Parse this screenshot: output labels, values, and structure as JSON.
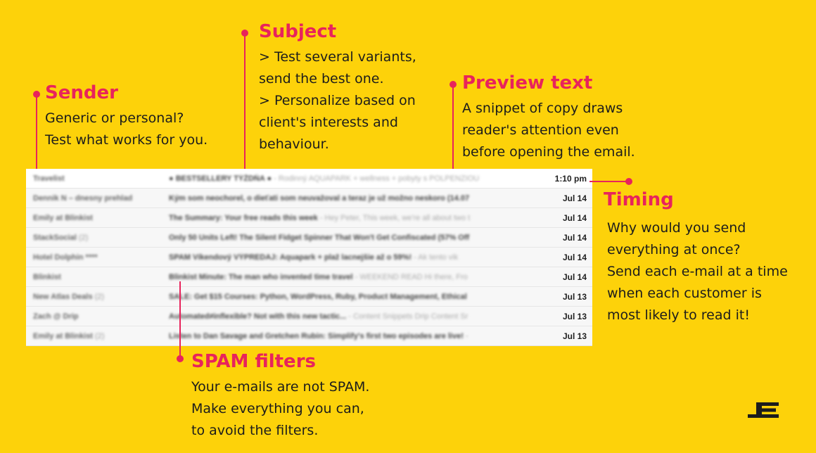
{
  "sender": {
    "title": "Sender",
    "lines": [
      "Generic or personal?",
      "Test what works for you."
    ]
  },
  "subject": {
    "title": "Subject",
    "lines": [
      "> Test several variants,",
      "send the best one.",
      "> Personalize based on",
      "client's interests and",
      "behaviour."
    ]
  },
  "preview": {
    "title": "Preview text",
    "lines": [
      "A snippet of copy draws",
      "reader's attention even",
      "before opening the email."
    ]
  },
  "timing": {
    "title": "Timing",
    "lines": [
      "Why would you send",
      "everything at once?",
      "Send each e-mail at a time",
      "when each customer is",
      "most likely to read it!"
    ]
  },
  "spam": {
    "title": "SPAM filters",
    "lines": [
      "Your e-mails are not SPAM.",
      "Make everything you can,",
      "to avoid the filters."
    ]
  },
  "inbox": {
    "rows": [
      {
        "sender": "Travelist",
        "count": "",
        "subject": "● BESTSELLERY TÝŽDŇA ●",
        "preview": " - Rodinný AQUAPARK + wellness + pobyty s POLPENZIOU",
        "date": "1:10 pm"
      },
      {
        "sender": "Dennik N – dnesny prehlad",
        "count": "",
        "subject": "Kým som neochorel, o dieťati som neuvažoval a teraz je už možno neskoro (14.07",
        "preview": "",
        "date": "Jul 14"
      },
      {
        "sender": "Emily at Blinkist",
        "count": "",
        "subject": "The Summary: Your free reads this week",
        "preview": " - Hey Peter, This week, we're all about two t",
        "date": "Jul 14"
      },
      {
        "sender": "StackSocial",
        "count": "(2)",
        "subject": "Only 50 Units Left! The Silent Fidget Spinner That Won't Get Confiscated (57% Off",
        "preview": "",
        "date": "Jul 14"
      },
      {
        "sender": "Hotel Dolphin ****",
        "count": "",
        "subject": "SPAM   Víkendový VÝPREDAJ: Aquapark + plaž lacnejšie až o 59%!",
        "preview": " - Ak tento vik",
        "date": "Jul 14"
      },
      {
        "sender": "Blinkist",
        "count": "",
        "subject": "Blinkist Minute: The man who invented time travel",
        "preview": " - WEEKEND READ Hi there, Fro",
        "date": "Jul 14"
      },
      {
        "sender": "New Atlas Deals",
        "count": "(2)",
        "subject": "SALE: Get $15 Courses: Python, WordPress, Ruby, Product Management, Ethical",
        "preview": "",
        "date": "Jul 13"
      },
      {
        "sender": "Zach @ Drip",
        "count": "",
        "subject": "Automated≠inflexible? Not with this new tactic...",
        "preview": " - Content Snippets Drip Content Sr",
        "date": "Jul 13"
      },
      {
        "sender": "Emily at Blinkist",
        "count": "(2)",
        "subject": "Listen to Dan Savage and Gretchen Rubin: Simplify's first two episodes are live!",
        "preview": " -",
        "date": "Jul 13"
      }
    ]
  },
  "colors": {
    "background": "#FDD20A",
    "accent": "#E8235C",
    "text": "#1c1c1c"
  },
  "logo_icon": "E-logo-icon"
}
